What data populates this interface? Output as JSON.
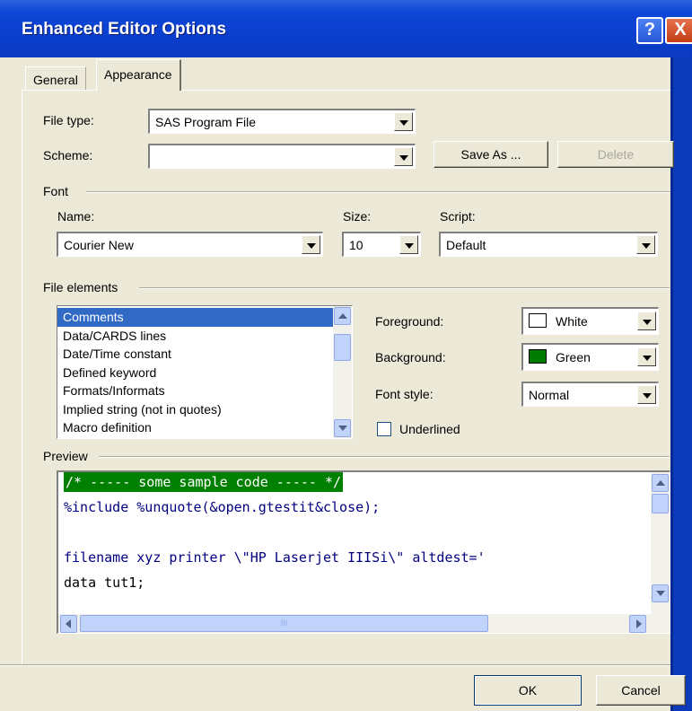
{
  "window": {
    "title": "Enhanced Editor Options",
    "help_glyph": "?",
    "close_glyph": "X"
  },
  "tabs": [
    {
      "label": "General",
      "active": false
    },
    {
      "label": "Appearance",
      "active": true
    }
  ],
  "file_type": {
    "label": "File type:",
    "value": "SAS Program File"
  },
  "scheme": {
    "label": "Scheme:",
    "value": ""
  },
  "buttons": {
    "save_as": "Save As ...",
    "delete": "Delete",
    "ok": "OK",
    "cancel": "Cancel"
  },
  "font": {
    "group_label": "Font",
    "name_label": "Name:",
    "name_value": "Courier New",
    "size_label": "Size:",
    "size_value": "10",
    "script_label": "Script:",
    "script_value": "Default"
  },
  "file_elements": {
    "group_label": "File elements",
    "items": [
      "Comments",
      "Data/CARDS lines",
      "Date/Time constant",
      "Defined keyword",
      "Formats/Informats",
      "Implied string (not in quotes)",
      "Macro definition"
    ],
    "selected_index": 0,
    "foreground_label": "Foreground:",
    "foreground_value": "White",
    "foreground_color": "#ffffff",
    "background_label": "Background:",
    "background_value": "Green",
    "background_color": "#007a00",
    "font_style_label": "Font style:",
    "font_style_value": "Normal",
    "underlined_label": "Underlined",
    "underlined_checked": false
  },
  "preview": {
    "label": "Preview",
    "lines": [
      {
        "text": "/* ----- some sample code ----- */",
        "color": "#ffffff",
        "bg": "#008000"
      },
      {
        "text": "%include %unquote(&open.gtestit&close);",
        "color": "#000080"
      },
      {
        "text": "",
        "color": "#000000"
      },
      {
        "text": "filename xyz printer \\\"HP Laserjet IIISi\\\" altdest='",
        "color": "#000080"
      },
      {
        "text": "data tut1;",
        "color": "#000000"
      }
    ],
    "scroll_glyph": "III"
  },
  "colors": {
    "titlebar": "#0a3fcf",
    "selection": "#316ac5",
    "dialog_bg": "#ece9d8"
  }
}
